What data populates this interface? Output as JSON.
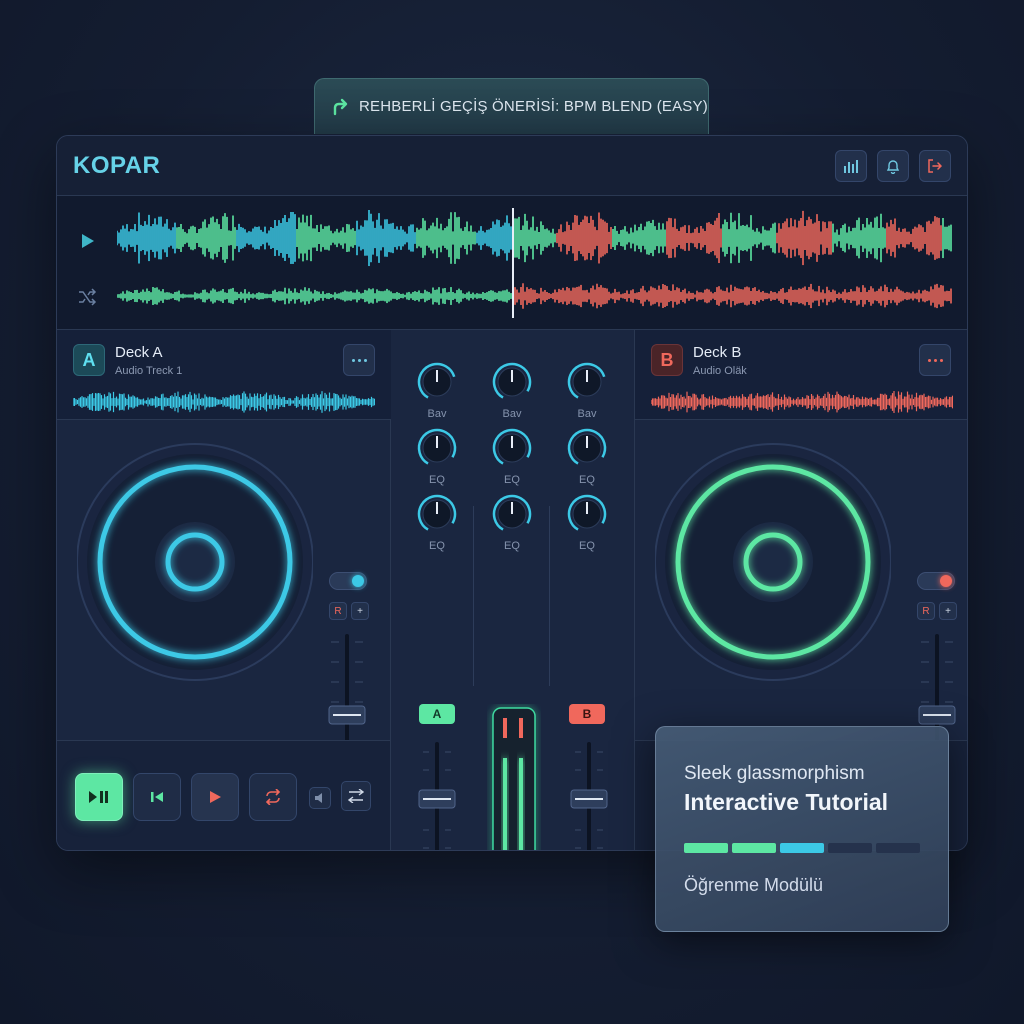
{
  "hint": {
    "text": "REHBERLİ GEÇİŞ ÖNERİSİ: BPM BLEND (EASY)",
    "icon": "guided-arrow-icon"
  },
  "app": {
    "title": "KOPAR",
    "header_buttons": [
      {
        "icon": "equalizer-bars-icon"
      },
      {
        "icon": "bell-icon"
      },
      {
        "icon": "logout-icon"
      }
    ]
  },
  "overview": {
    "play_icon": "play-icon",
    "shuffle_icon": "shuffle-icon"
  },
  "deck_a": {
    "badge": "A",
    "name": "Deck A",
    "track": "Audio Treck 1",
    "more_icon": "more-dots-icon",
    "toggle_on": true,
    "mini_r": "R",
    "mini_plus": "+",
    "accent": "#3cc9e6"
  },
  "deck_b": {
    "badge": "B",
    "name": "Deck B",
    "track": "Audio Oläk",
    "more_icon": "more-dots-icon",
    "toggle_on": true,
    "mini_r": "R",
    "mini_plus": "+",
    "accent": "#5de7a3"
  },
  "mixer": {
    "knob_labels": [
      [
        "Bav",
        "EQ",
        "EQ"
      ],
      [
        "Bav",
        "EQ",
        "EQ"
      ],
      [
        "Bav",
        "EQ",
        "EQ"
      ]
    ],
    "channel_a": "A",
    "channel_b": "B"
  },
  "transport": {
    "buttons": [
      "play-pause-icon",
      "cue-icon",
      "play-icon",
      "loop-icon",
      "volume-icon",
      "settings-sliders-icon"
    ]
  },
  "tutorial": {
    "line1": "Sleek glassmorphism",
    "line2": "Interactive Tutorial",
    "footer": "Öğrenme Modülü",
    "progress_segments": [
      "#5de7a3",
      "#5de7a3",
      "#3cc9e6",
      "#25324c",
      "#25324c"
    ]
  },
  "colors": {
    "cyan": "#3cc9e6",
    "green": "#5de7a3",
    "red": "#f0685c",
    "bg": "#17223a"
  }
}
